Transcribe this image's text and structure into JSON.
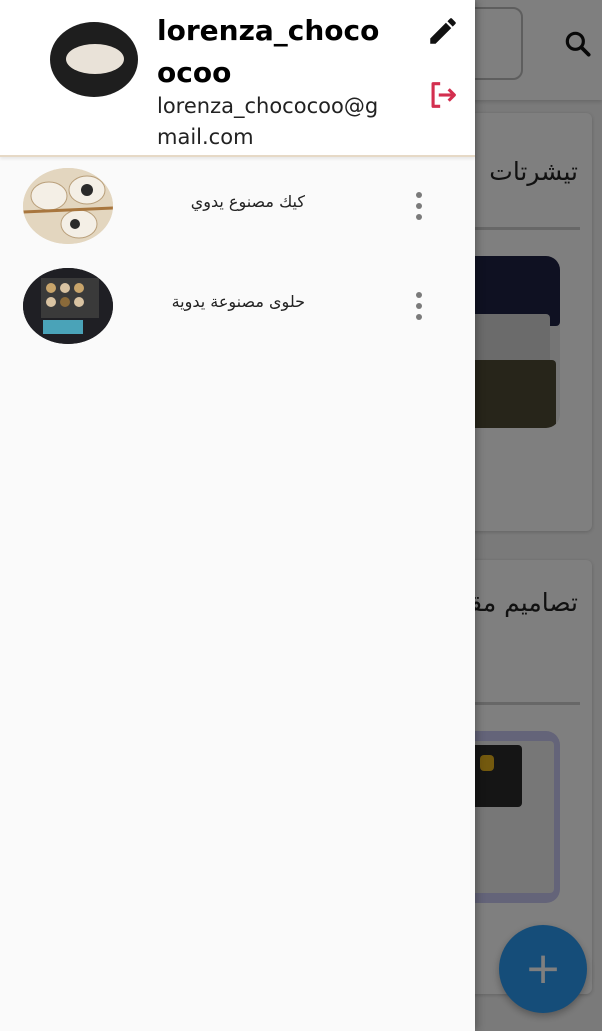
{
  "background": {
    "cards": [
      {
        "title": "تيشرتات"
      },
      {
        "title": "تصاميم مقا"
      }
    ],
    "icons": {
      "search": "search-icon",
      "fab": "plus-icon"
    },
    "fab_label": "+",
    "colors": {
      "fab": "#2b9af3"
    }
  },
  "drawer": {
    "header": {
      "username": "lorenza_chocoocoo",
      "email": "lorenza_chococoo@gmail.com",
      "icons": {
        "edit": "pencil-icon",
        "logout": "logout-icon"
      }
    },
    "items": [
      {
        "label": "كيك مصنوع يدوي"
      },
      {
        "label": "حلوى مصنوعة يدوية"
      }
    ],
    "colors": {
      "logout": "#d32f4f"
    }
  }
}
